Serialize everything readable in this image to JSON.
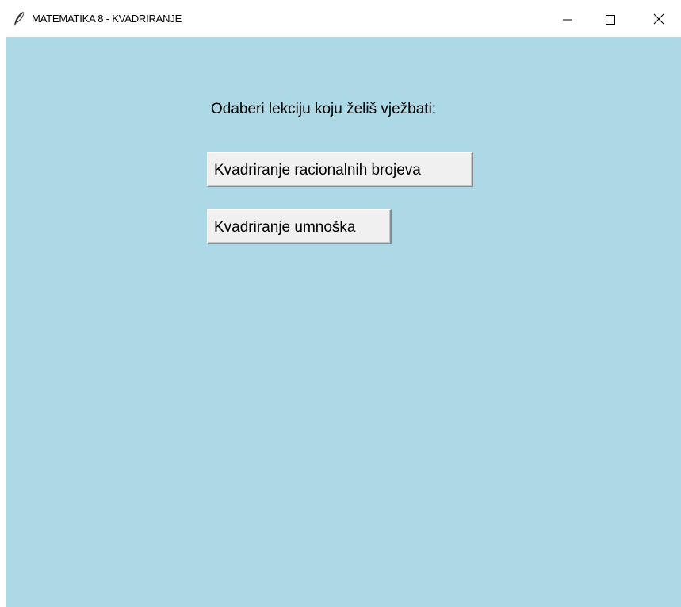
{
  "window": {
    "title": "MATEMATIKA 8 - KVADRIRANJE",
    "icon": "feather-icon",
    "controls": [
      "minimize-icon",
      "maximize-icon",
      "close-icon"
    ]
  },
  "main": {
    "prompt": "Odaberi lekciju koju želiš vježbati:",
    "lessons": [
      {
        "label": "Kvadriranje racionalnih brojeva"
      },
      {
        "label": "Kvadriranje umnoška"
      }
    ]
  },
  "colors": {
    "background": "#add8e6",
    "button_face": "#f0f0f0",
    "titlebar": "#ffffff"
  }
}
